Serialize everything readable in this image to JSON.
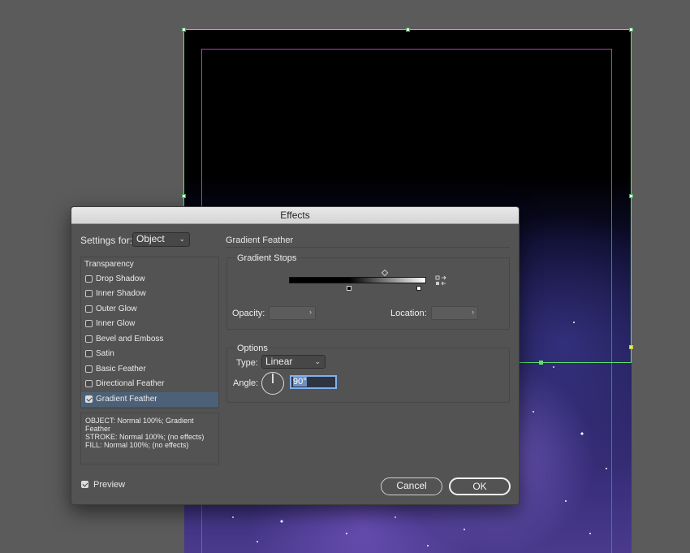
{
  "dialog": {
    "title": "Effects",
    "settings_for_label": "Settings for:",
    "settings_for_value": "Object",
    "effects_header": "Transparency",
    "effects": [
      {
        "label": "Drop Shadow",
        "checked": false
      },
      {
        "label": "Inner Shadow",
        "checked": false
      },
      {
        "label": "Outer Glow",
        "checked": false
      },
      {
        "label": "Inner Glow",
        "checked": false
      },
      {
        "label": "Bevel and Emboss",
        "checked": false
      },
      {
        "label": "Satin",
        "checked": false
      },
      {
        "label": "Basic Feather",
        "checked": false
      },
      {
        "label": "Directional Feather",
        "checked": false
      },
      {
        "label": "Gradient Feather",
        "checked": true,
        "selected": true
      }
    ],
    "summary": [
      "OBJECT: Normal 100%; Gradient Feather",
      "STROKE: Normal 100%; (no effects)",
      "FILL: Normal 100%; (no effects)"
    ],
    "preview_label": "Preview",
    "preview_checked": true,
    "section_title": "Gradient Feather",
    "gradient_stops": {
      "title": "Gradient Stops",
      "opacity_label": "Opacity:",
      "location_label": "Location:",
      "reverse_icon": "reverse-gradient-icon"
    },
    "options": {
      "title": "Options",
      "type_label": "Type:",
      "type_value": "Linear",
      "angle_label": "Angle:",
      "angle_value": "90°"
    },
    "cancel_label": "Cancel",
    "ok_label": "OK"
  },
  "colors": {
    "selection_frame": "#5fe36f",
    "margin_guide": "#b23bb8",
    "list_selection": "#4c6178",
    "focus_ring": "#7fb1f0"
  }
}
